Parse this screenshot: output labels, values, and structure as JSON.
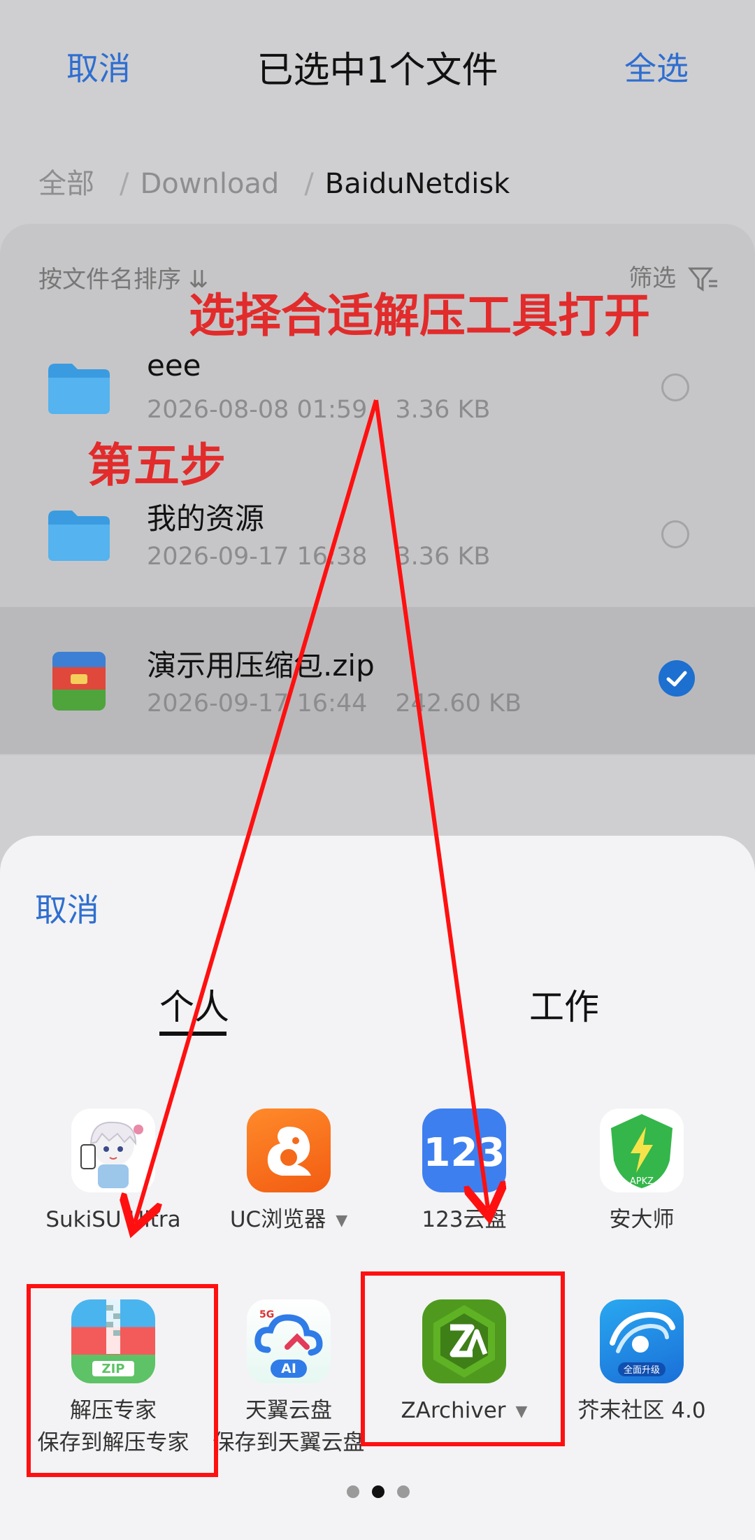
{
  "header": {
    "cancel_label": "取消",
    "title": "已选中1个文件",
    "select_all_label": "全选"
  },
  "breadcrumb": {
    "root": "全部",
    "parent": "Download",
    "current": "BaiduNetdisk",
    "separator": "/"
  },
  "list": {
    "sort_label": "按文件名排序 ⇊",
    "filter_label": "筛选",
    "files": [
      {
        "name": "eee",
        "date": "2026-08-08 01:59",
        "size": "3.36 KB",
        "type": "folder",
        "selected": false
      },
      {
        "name": "我的资源",
        "date": "2026-09-17 16:38",
        "size": "3.36 KB",
        "type": "folder",
        "selected": false
      },
      {
        "name": "演示用压缩包.zip",
        "date": "2026-09-17 16:44",
        "size": "242.60 KB",
        "type": "zip",
        "selected": true
      }
    ]
  },
  "sheet": {
    "cancel_label": "取消",
    "tabs": [
      {
        "label": "个人",
        "active": true
      },
      {
        "label": "工作",
        "active": false
      }
    ],
    "apps_row1": [
      {
        "label": "SukiSU Ultra",
        "icon": "anime-character-icon"
      },
      {
        "label": "UC浏览器",
        "icon": "uc-squirrel-icon",
        "has_dropdown": true
      },
      {
        "label": "123云盘",
        "icon": "123-logo-icon"
      },
      {
        "label": "安大师",
        "icon": "apkz-shield-icon"
      }
    ],
    "apps_row2": [
      {
        "label": "解压专家",
        "sub": "保存到解压专家",
        "icon": "zip-zipper-icon"
      },
      {
        "label": "天翼云盘",
        "sub": "保存到天翼云盘",
        "icon": "cloud-ai-icon"
      },
      {
        "label": "ZArchiver",
        "icon": "zarchiver-logo-icon",
        "has_dropdown": true
      },
      {
        "label": "芥末社区 4.0",
        "icon": "mustard-community-icon"
      }
    ],
    "page_dots": {
      "count": 3,
      "active_index": 1
    }
  },
  "annotations": {
    "title_text": "选择合适解压工具打开",
    "step_text": "第五步"
  },
  "colors": {
    "accent": "#2f6ed0",
    "annotation_red": "#e22b2b",
    "check_blue": "#1d6fd0"
  }
}
